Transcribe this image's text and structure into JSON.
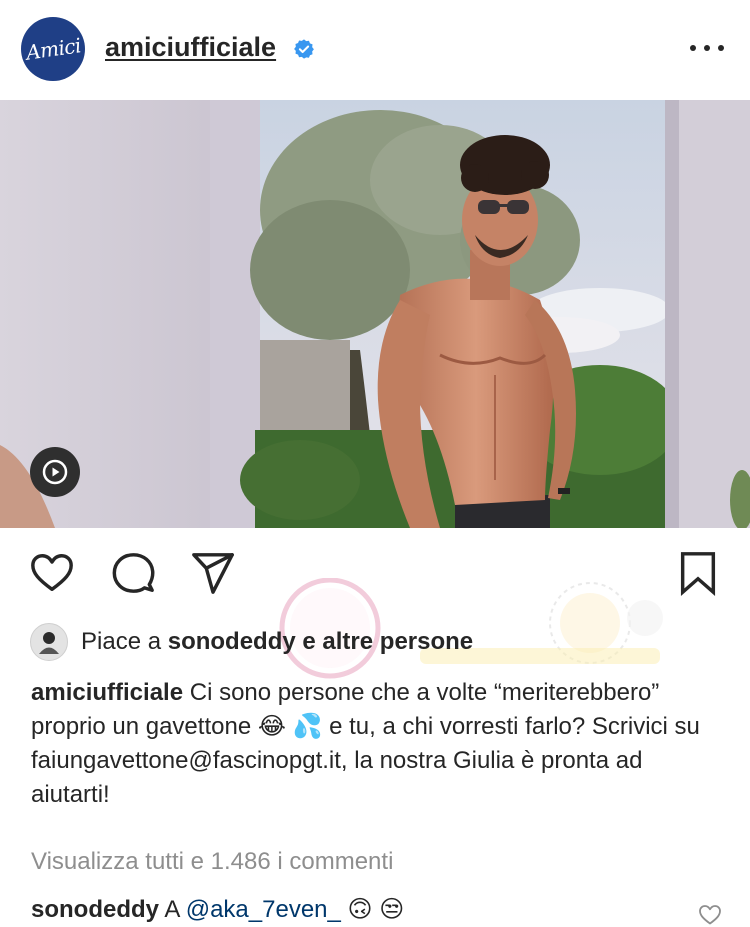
{
  "header": {
    "avatar_text": "Amici",
    "username": "amiciufficiale",
    "verified": true,
    "more_icon": "more-horizontal-icon"
  },
  "media": {
    "description_icon": "play-icon",
    "type": "video"
  },
  "actions": {
    "like_icon": "heart-outline-icon",
    "comment_icon": "comment-bubble-icon",
    "share_icon": "send-paper-plane-icon",
    "save_icon": "bookmark-icon"
  },
  "likes": {
    "prefix": "Piace a ",
    "user": "sonodeddy",
    "suffix": " e altre persone"
  },
  "caption": {
    "user": "amiciufficiale",
    "text_part1": " Ci sono persone che a volte “meriterebbero” proprio un gavettone ",
    "emoji1": "😂",
    "emoji2": "💦",
    "text_part2": " e tu, a chi vorresti farlo? Scrivici su faiungavettone@fascinopgt.it, la nostra Giulia è pronta ad aiutarti!"
  },
  "comments": {
    "view_all": "Visualizza tutti e 1.486 i commenti",
    "first": {
      "user": "sonodeddy",
      "text": " A ",
      "mention": "@aka_7even_",
      "emoji1": "🙃",
      "emoji2": "😒"
    }
  },
  "colors": {
    "accent_blue": "#3897f0",
    "mention": "#00376b",
    "muted": "#8e8e8e",
    "text": "#262626",
    "brand_avatar": "#1f3f86"
  }
}
